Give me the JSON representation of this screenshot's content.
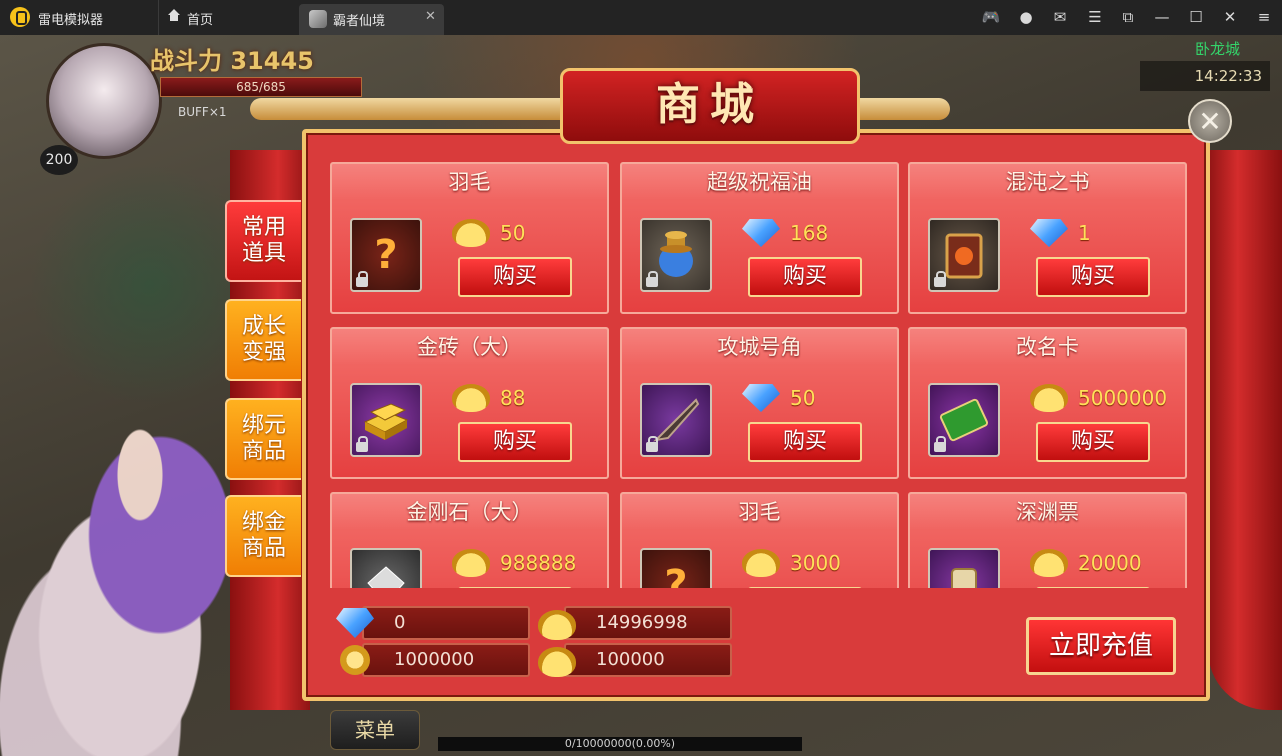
{
  "window": {
    "app_name": "雷电模拟器",
    "tabs": [
      {
        "label": "首页"
      },
      {
        "label": "霸者仙境"
      }
    ],
    "controls": [
      "gamepad-icon",
      "account-icon",
      "mail-icon",
      "menu-icon",
      "popout-icon",
      "minimize-icon",
      "maximize-icon",
      "close-icon"
    ]
  },
  "hud": {
    "combat_power": "战斗力 31445",
    "hp": "685/685",
    "buff": "BUFF×1",
    "level": "200",
    "location": "卧龙城",
    "time": "14:22:33",
    "menu_label": "菜单",
    "exp": "0/10000000(0.00%)"
  },
  "shop": {
    "title": "商城",
    "categories": [
      {
        "label": "常用道具",
        "active": true
      },
      {
        "label": "成长变强",
        "active": false
      },
      {
        "label": "绑元商品",
        "active": false
      },
      {
        "label": "绑金商品",
        "active": false
      }
    ],
    "buy_label": "购买",
    "items": [
      {
        "name": "羽毛",
        "currency": "gold-ingot",
        "price": "50",
        "icon": "question-icon"
      },
      {
        "name": "超级祝福油",
        "currency": "diamond",
        "price": "168",
        "icon": "vase-icon"
      },
      {
        "name": "混沌之书",
        "currency": "diamond",
        "price": "1",
        "icon": "book-icon"
      },
      {
        "name": "金砖（大）",
        "currency": "gold-ingot",
        "price": "88",
        "icon": "gold-bars-icon"
      },
      {
        "name": "攻城号角",
        "currency": "diamond",
        "price": "50",
        "icon": "horn-icon"
      },
      {
        "name": "改名卡",
        "currency": "gold-ingot",
        "price": "5000000",
        "icon": "rename-card-icon"
      },
      {
        "name": "金刚石（大）",
        "currency": "gold-ingot",
        "price": "988888",
        "icon": "gem-icon"
      },
      {
        "name": "羽毛",
        "currency": "gold-ingot",
        "price": "3000",
        "icon": "question-icon"
      },
      {
        "name": "深渊票",
        "currency": "gold-ingot",
        "price": "20000",
        "icon": "scroll-icon"
      }
    ],
    "balances": {
      "diamond": "0",
      "gold_ingot": "14996998",
      "bound_coin": "1000000",
      "bound_ingot": "100000"
    },
    "recharge_label": "立即充值"
  },
  "colors": {
    "panel": "#d93b3b",
    "card": "#e54040",
    "accent_gold": "#f2c36c",
    "price": "#ffe05a",
    "category_active": "#c31414",
    "category_inactive": "#f07e04"
  }
}
